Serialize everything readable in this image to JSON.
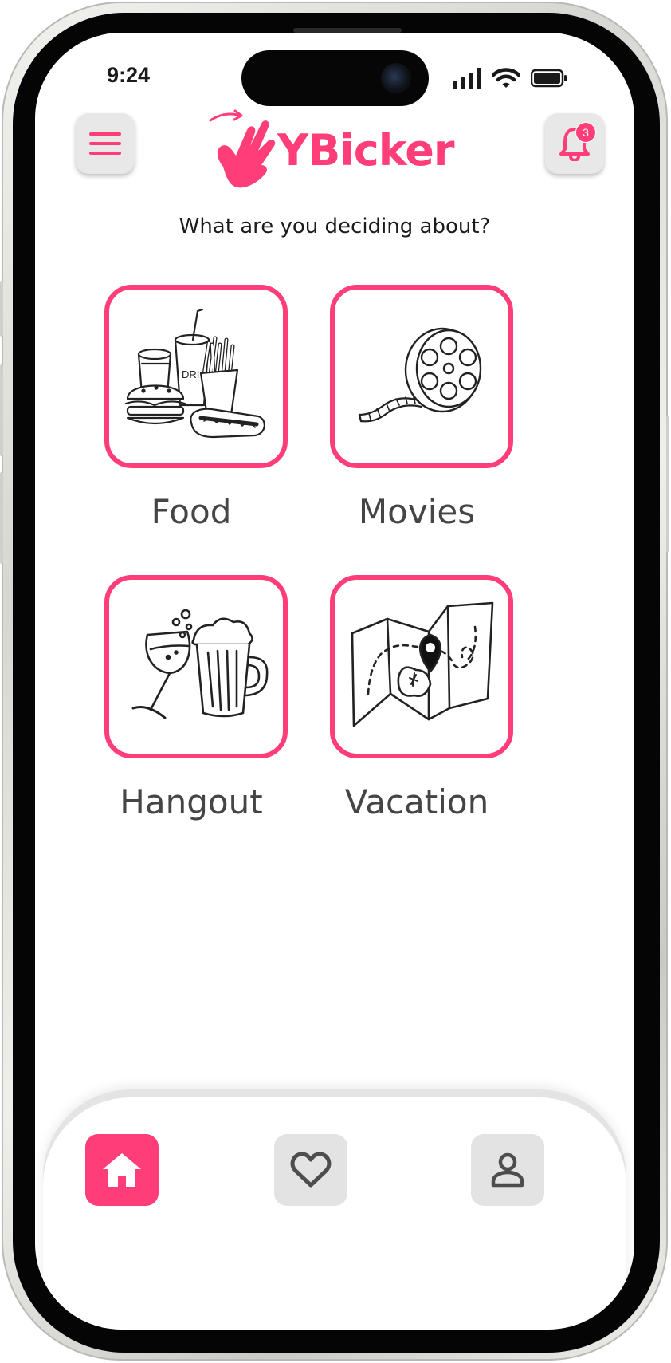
{
  "status_bar": {
    "time": "9:24"
  },
  "header": {
    "app_name": "YBicker",
    "notification_count": "3",
    "menu_icon": "hamburger-menu-icon",
    "notification_icon": "bell-icon"
  },
  "prompt": "What are you deciding about?",
  "categories": [
    {
      "label": "Food",
      "icon": "fast-food-illustration"
    },
    {
      "label": "Movies",
      "icon": "film-reel-illustration"
    },
    {
      "label": "Hangout",
      "icon": "drinks-toast-illustration"
    },
    {
      "label": "Vacation",
      "icon": "treasure-map-illustration"
    }
  ],
  "bottom_nav": [
    {
      "name": "home",
      "icon": "home-icon",
      "active": true
    },
    {
      "name": "favorites",
      "icon": "heart-icon",
      "active": false
    },
    {
      "name": "profile",
      "icon": "user-icon",
      "active": false
    }
  ],
  "colors": {
    "accent": "#ff3d79",
    "button_bg": "#e3e3e3",
    "text": "#454545"
  }
}
